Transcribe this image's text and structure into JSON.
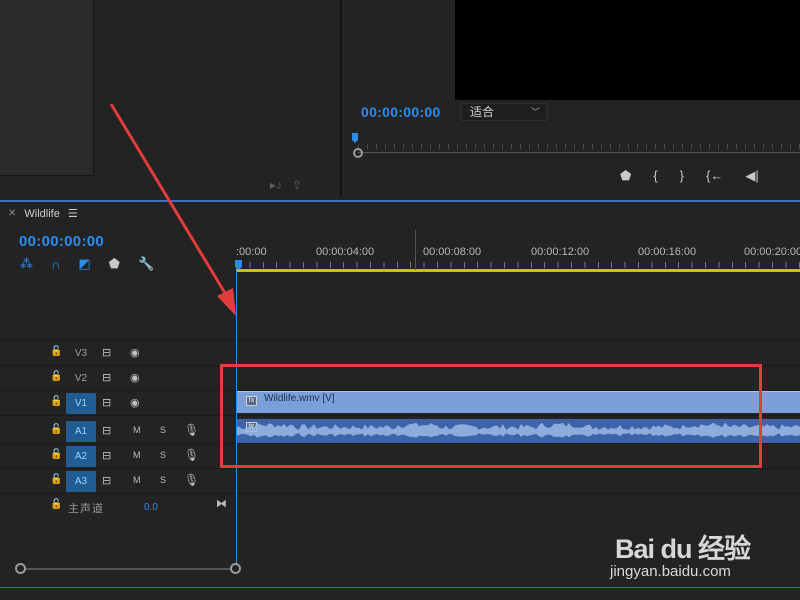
{
  "program_monitor": {
    "timecode": "00:00:00:00",
    "fit_label": "适合"
  },
  "timeline": {
    "sequence_name": "Wildlife",
    "timecode": "00:00:00:00",
    "ruler_labels": [
      ":00:00",
      "00:00:04:00",
      "00:00:08:00",
      "00:00:12:00",
      "00:00:16:00",
      "00:00:20:00"
    ],
    "tracks": {
      "v3": "V3",
      "v2": "V2",
      "v1": "V1",
      "a1": "A1",
      "a2": "A2",
      "a3": "A3"
    },
    "mute_label": "M",
    "solo_label": "S",
    "master": {
      "label": "主声道",
      "value": "0.0"
    },
    "clips": {
      "video": "Wildlife.wmv [V]",
      "fx": "fx"
    }
  },
  "watermark": {
    "logo": "Bai du 经验",
    "url": "jingyan.baidu.com"
  },
  "colors": {
    "accent": "#2d8ceb",
    "video_clip": "#7b9fd8",
    "audio_clip": "#3f63a8",
    "annotation": "#e23c3c",
    "work_area": "#c9c300"
  }
}
